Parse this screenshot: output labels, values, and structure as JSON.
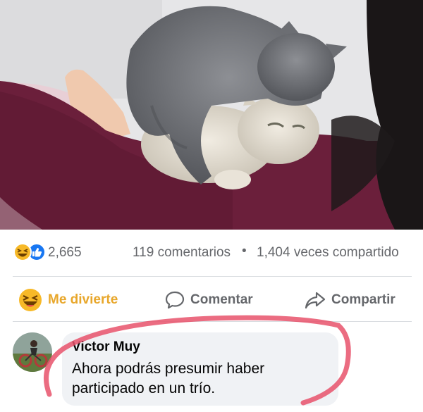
{
  "post": {
    "photo_icon": "cats-on-shoulder-photo",
    "reactions": {
      "icons": [
        "haha-icon",
        "like-icon"
      ],
      "count": "2,665"
    },
    "comments_count": "119 comentarios",
    "separator": "•",
    "shares_count": "1,404 veces compartido"
  },
  "actions": {
    "haha_label": "Me divierte",
    "comment_label": "Comentar",
    "share_label": "Compartir"
  },
  "comment": {
    "author": "Victor Muy",
    "text": "Ahora podrás presumir haber participado en un trío."
  },
  "colors": {
    "haha_yellow": "#f7b928",
    "like_blue": "#1877f2",
    "secondary_text": "#65676b",
    "annotation_red": "#e8526b"
  }
}
